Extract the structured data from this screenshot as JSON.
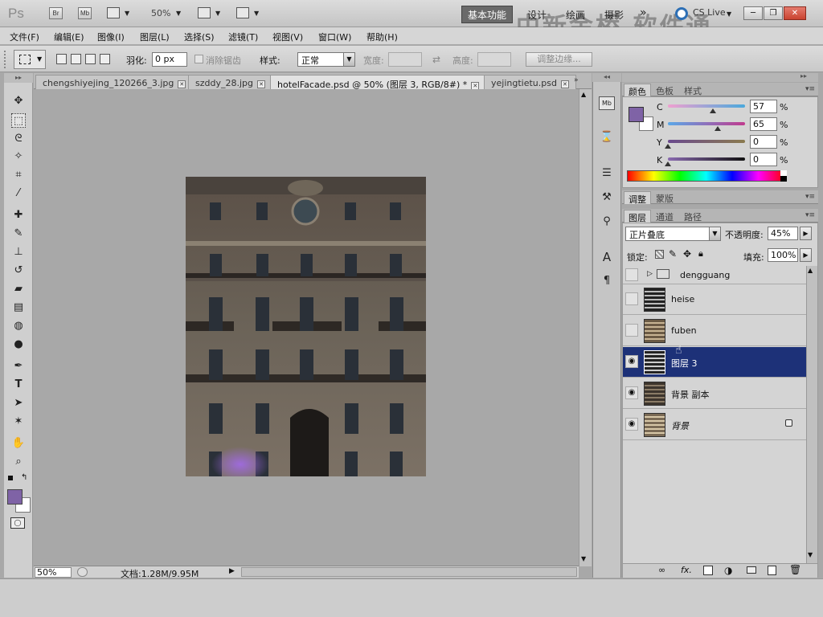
{
  "app": {
    "logo": "Ps",
    "bridge_label": "Br",
    "minibridge_label": "Mb",
    "zoom": "50%",
    "workspace_active": "基本功能",
    "workspaces": [
      "设计",
      "绘画",
      "摄影"
    ],
    "overflow": "»",
    "cs_live": "CS Live",
    "watermark": "中新金桥 软件通"
  },
  "menu": [
    "文件(F)",
    "编辑(E)",
    "图像(I)",
    "图层(L)",
    "选择(S)",
    "滤镜(T)",
    "视图(V)",
    "窗口(W)",
    "帮助(H)"
  ],
  "options": {
    "feather_label": "羽化:",
    "feather_value": "0 px",
    "antialias_label": "消除锯齿",
    "style_label": "样式:",
    "style_value": "正常",
    "width_label": "宽度:",
    "height_label": "高度:",
    "refine_edge": "调整边缘..."
  },
  "tabs": [
    {
      "label": "chengshiyejing_120266_3.jpg",
      "active": false
    },
    {
      "label": "szddy_28.jpg",
      "active": false
    },
    {
      "label": "hotelFacade.psd @ 50% (图层 3, RGB/8#) *",
      "active": true
    },
    {
      "label": "yejingtietu.psd",
      "active": false
    }
  ],
  "status": {
    "zoom": "50%",
    "doc_info": "文档:1.28M/9.95M"
  },
  "color_panel": {
    "tabs": [
      "颜色",
      "色板",
      "样式"
    ],
    "channels": [
      {
        "name": "C",
        "value": "57"
      },
      {
        "name": "M",
        "value": "65"
      },
      {
        "name": "Y",
        "value": "0"
      },
      {
        "name": "K",
        "value": "0"
      }
    ],
    "pct": "%",
    "foreground": "#7f63a6"
  },
  "adjust_panel": {
    "tabs": [
      "调整",
      "蒙版"
    ]
  },
  "layers_panel": {
    "tabs": [
      "图层",
      "通道",
      "路径"
    ],
    "blend_mode": "正片叠底",
    "opacity_label": "不透明度:",
    "opacity_value": "45%",
    "lock_label": "锁定:",
    "fill_label": "填充:",
    "fill_value": "100%",
    "layers": [
      {
        "name": "dengguang",
        "group": true,
        "visible": false
      },
      {
        "name": "heise",
        "visible": false
      },
      {
        "name": "fuben",
        "visible": false
      },
      {
        "name": "图层 3",
        "visible": true,
        "selected": true
      },
      {
        "name": "背景 副本",
        "visible": true
      },
      {
        "name": "背景",
        "visible": true,
        "locked": true
      }
    ]
  }
}
